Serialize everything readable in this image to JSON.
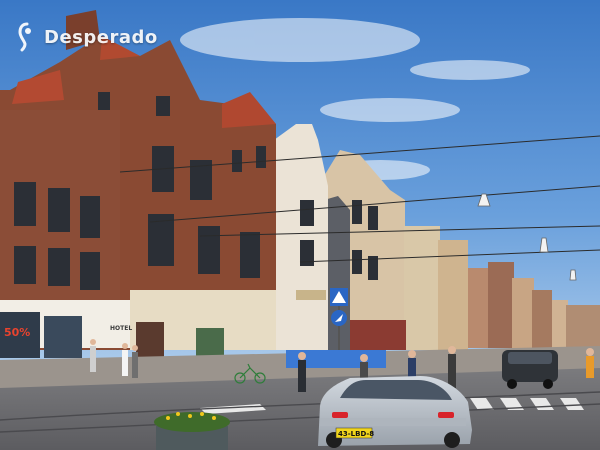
{
  "watermark": {
    "text": "Desperado",
    "icon": "desperado-logo-icon"
  },
  "signs": {
    "shop_sale": "50%",
    "hotel": "HOTEL",
    "plate": "43-LBD-8"
  },
  "colors": {
    "sky_top": "#3b79c7",
    "sky_bottom": "#8fbbe6",
    "brick": "#8a4a33",
    "brick_dark": "#6e3a28",
    "road": "#6b6b6e",
    "sidewalk": "#9b948d",
    "car_silver": "#b9c0c8",
    "car_dark": "#2f3338",
    "sign_blue": "#2a66c4"
  }
}
